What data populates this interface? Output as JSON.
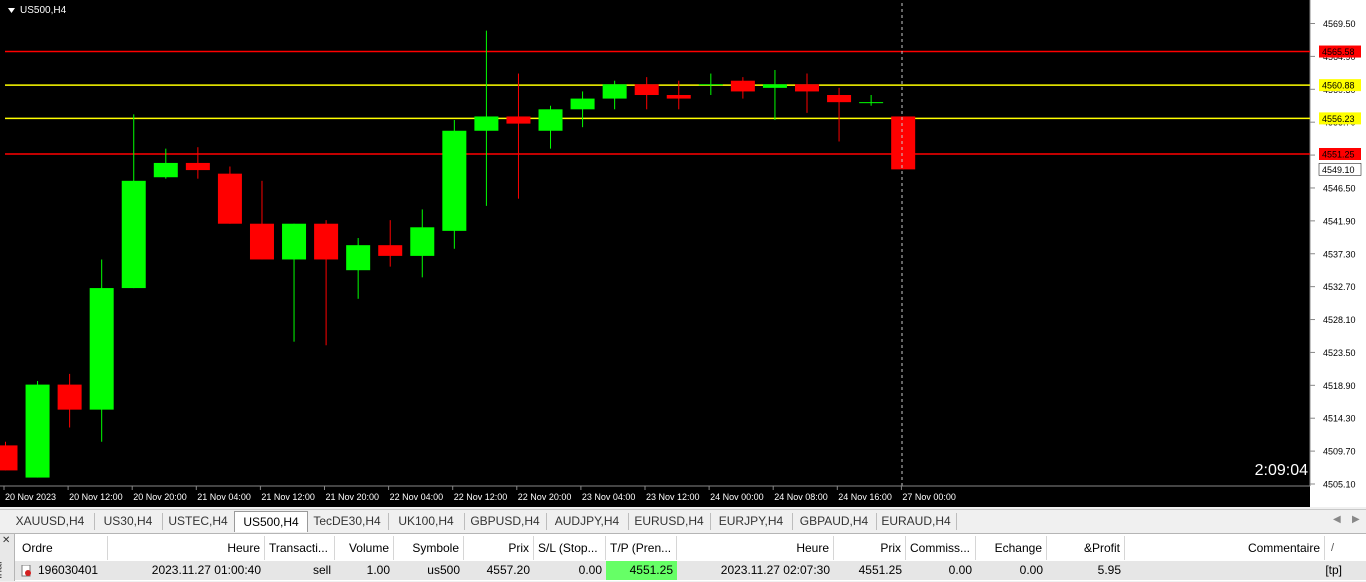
{
  "chart": {
    "symbol_title": "US500,H4",
    "countdown": "2:09:04",
    "price_axis": {
      "ticks": [
        "4569.50",
        "4564.90",
        "4560.30",
        "4555.70",
        "4551.10",
        "4546.50",
        "4541.90",
        "4537.30",
        "4532.70",
        "4528.10",
        "4523.50",
        "4518.90",
        "4514.30",
        "4509.70",
        "4505.10"
      ]
    },
    "time_axis": {
      "labels": [
        "20 Nov 2023",
        "20 Nov 12:00",
        "20 Nov 20:00",
        "21 Nov 04:00",
        "21 Nov 12:00",
        "21 Nov 20:00",
        "22 Nov 04:00",
        "22 Nov 12:00",
        "22 Nov 20:00",
        "23 Nov 04:00",
        "23 Nov 12:00",
        "24 Nov 00:00",
        "24 Nov 08:00",
        "24 Nov 16:00",
        "27 Nov 00:00"
      ]
    },
    "levels": [
      {
        "label": "4565.58",
        "price": 4565.58,
        "color": "#ff0000"
      },
      {
        "label": "4560.88",
        "price": 4560.88,
        "color": "#ffff00"
      },
      {
        "label": "4556.23",
        "price": 4556.23,
        "color": "#ffff00"
      },
      {
        "label": "4551.25",
        "price": 4551.25,
        "color": "#ff0000"
      }
    ],
    "current_price": "4549.10",
    "colors": {
      "background": "#000000",
      "bull": "#00ff00",
      "bear": "#ff0000",
      "axis_text": "#000000"
    }
  },
  "chart_data": {
    "type": "candlestick",
    "title": "US500,H4",
    "ylim": [
      4505.1,
      4571.0
    ],
    "series": [
      {
        "candles": [
          {
            "o": 4510.5,
            "h": 4511.0,
            "l": 4507.0,
            "c": 4507.0
          },
          {
            "o": 4506.0,
            "h": 4519.5,
            "l": 4506.0,
            "c": 4519.0
          },
          {
            "o": 4519.0,
            "h": 4520.5,
            "l": 4513.0,
            "c": 4515.5
          },
          {
            "o": 4515.5,
            "h": 4536.5,
            "l": 4511.0,
            "c": 4532.5
          },
          {
            "o": 4532.5,
            "h": 4556.8,
            "l": 4532.5,
            "c": 4547.5
          },
          {
            "o": 4548.0,
            "h": 4552.0,
            "l": 4547.8,
            "c": 4550.0
          },
          {
            "o": 4550.0,
            "h": 4552.2,
            "l": 4547.8,
            "c": 4549.0
          },
          {
            "o": 4548.5,
            "h": 4549.5,
            "l": 4541.5,
            "c": 4541.5
          },
          {
            "o": 4541.5,
            "h": 4547.5,
            "l": 4536.5,
            "c": 4536.5
          },
          {
            "o": 4536.5,
            "h": 4541.5,
            "l": 4525.0,
            "c": 4541.5
          },
          {
            "o": 4541.5,
            "h": 4542.0,
            "l": 4524.5,
            "c": 4536.5
          },
          {
            "o": 4535.0,
            "h": 4539.5,
            "l": 4531.0,
            "c": 4538.5
          },
          {
            "o": 4538.5,
            "h": 4542.0,
            "l": 4535.5,
            "c": 4537.0
          },
          {
            "o": 4537.0,
            "h": 4543.5,
            "l": 4534.0,
            "c": 4541.0
          },
          {
            "o": 4540.5,
            "h": 4556.0,
            "l": 4538.0,
            "c": 4554.5
          },
          {
            "o": 4554.5,
            "h": 4568.5,
            "l": 4544.0,
            "c": 4556.5
          },
          {
            "o": 4556.5,
            "h": 4562.5,
            "l": 4545.0,
            "c": 4555.5
          },
          {
            "o": 4554.5,
            "h": 4558.0,
            "l": 4552.0,
            "c": 4557.5
          },
          {
            "o": 4557.5,
            "h": 4560.0,
            "l": 4555.0,
            "c": 4559.0
          },
          {
            "o": 4559.0,
            "h": 4561.5,
            "l": 4557.5,
            "c": 4561.0
          },
          {
            "o": 4561.0,
            "h": 4562.0,
            "l": 4557.5,
            "c": 4559.5
          },
          {
            "o": 4559.5,
            "h": 4561.5,
            "l": 4557.5,
            "c": 4559.0
          },
          {
            "o": 4561.0,
            "h": 4562.5,
            "l": 4559.5,
            "c": 4561.0
          },
          {
            "o": 4561.5,
            "h": 4562.0,
            "l": 4559.0,
            "c": 4560.0
          },
          {
            "o": 4560.5,
            "h": 4563.0,
            "l": 4556.0,
            "c": 4561.0
          },
          {
            "o": 4561.0,
            "h": 4562.5,
            "l": 4557.0,
            "c": 4560.0
          },
          {
            "o": 4559.5,
            "h": 4560.5,
            "l": 4553.0,
            "c": 4558.5
          },
          {
            "o": 4558.5,
            "h": 4559.5,
            "l": 4558.0,
            "c": 4558.5
          },
          {
            "o": 4556.5,
            "h": 4556.5,
            "l": 4549.1,
            "c": 4549.1
          }
        ]
      }
    ]
  },
  "tabs": [
    "XAUUSD,H4",
    "US30,H4",
    "USTEC,H4",
    "US500,H4",
    "TecDE30,H4",
    "UK100,H4",
    "GBPUSD,H4",
    "AUDJPY,H4",
    "EURUSD,H4",
    "EURJPY,H4",
    "GBPAUD,H4",
    "EURAUD,H4"
  ],
  "active_tab": "US500,H4",
  "terminal": {
    "side_label": "inal",
    "headers": [
      "Ordre",
      "Heure",
      "Transacti...",
      "Volume",
      "Symbole",
      "Prix",
      "S/L (Stop...",
      "T/P (Pren...",
      "Heure",
      "Prix",
      "Commiss...",
      "Echange",
      "&Profit",
      "Commentaire"
    ],
    "row": {
      "order": "196030401",
      "time_open": "2023.11.27 01:00:40",
      "type": "sell",
      "volume": "1.00",
      "symbol": "us500",
      "price_open": "4557.20",
      "sl": "0.00",
      "tp": "4551.25",
      "time_close": "2023.11.27 02:07:30",
      "price_close": "4551.25",
      "commission": "0.00",
      "swap": "0.00",
      "profit": "5.95",
      "comment": "[tp]"
    },
    "tp_highlight_color": "#66ff66"
  }
}
